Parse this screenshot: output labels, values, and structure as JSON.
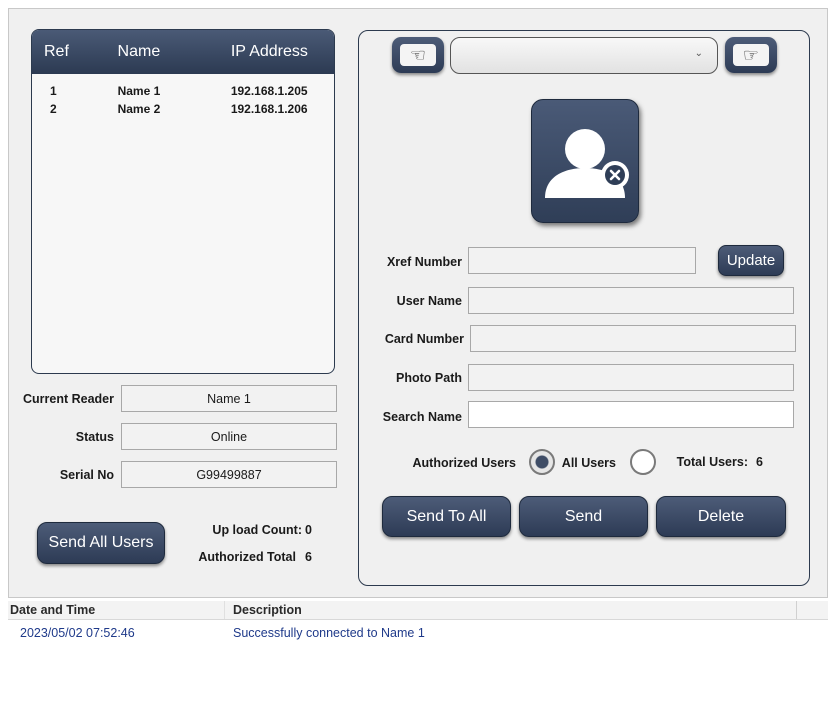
{
  "reader_table": {
    "columns": [
      "Ref",
      "Name",
      "IP Address"
    ],
    "rows": [
      {
        "ref": "1",
        "name": "Name 1",
        "ip": "192.168.1.205"
      },
      {
        "ref": "2",
        "name": "Name 2",
        "ip": "192.168.1.206"
      }
    ]
  },
  "reader_info": {
    "current_reader_label": "Current Reader",
    "current_reader_value": "Name 1",
    "status_label": "Status",
    "status_value": "Online",
    "serial_label": "Serial No",
    "serial_value": "G99499887"
  },
  "send_all_users_label": "Send All Users",
  "counts": {
    "upload_label": "Up load Count:",
    "upload_value": "0",
    "authorized_label": "Authorized Total",
    "authorized_value": "6"
  },
  "user_panel": {
    "prev_icon": "hand-pointing-left-icon",
    "next_icon": "hand-pointing-right-icon",
    "combo_value": "",
    "avatar_icon": "user-remove-icon",
    "xref_label": "Xref Number",
    "xref_value": "",
    "update_label": "Update",
    "username_label": "User Name",
    "username_value": "",
    "card_label": "Card Number",
    "card_value": "",
    "photo_label": "Photo Path",
    "photo_value": "",
    "search_label": "Search Name",
    "search_value": "",
    "authorized_users_label": "Authorized Users",
    "all_users_label": "All Users",
    "selected_filter": "Authorized Users",
    "total_users_label": "Total Users:",
    "total_users_value": "6",
    "send_to_all_label": "Send To All",
    "send_label": "Send",
    "delete_label": "Delete"
  },
  "log": {
    "columns": [
      "Date and Time",
      "Description"
    ],
    "rows": [
      {
        "time": "2023/05/02 07:52:46",
        "description": "Successfully connected to Name 1"
      }
    ]
  },
  "colors": {
    "button_dark": "#2d3b55",
    "button_light": "#4d5c78",
    "log_text": "#1f3a8a"
  }
}
